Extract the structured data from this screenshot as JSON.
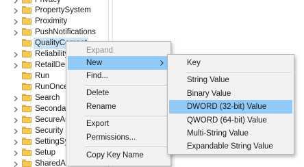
{
  "tree": {
    "items": [
      {
        "label": "Privacy"
      },
      {
        "label": "PropertySystem"
      },
      {
        "label": "Proximity"
      },
      {
        "label": "PushNotifications"
      },
      {
        "label": "QualityCompat"
      },
      {
        "label": "Reliability"
      },
      {
        "label": "RetailDemo"
      },
      {
        "label": "Run"
      },
      {
        "label": "RunOnce"
      },
      {
        "label": "Search"
      },
      {
        "label": "SecondaryAuth"
      },
      {
        "label": "SecureAssessment"
      },
      {
        "label": "Security and Maintenance"
      },
      {
        "label": "SettingSync"
      },
      {
        "label": "Setup"
      },
      {
        "label": "SharedAccess"
      }
    ]
  },
  "context_menu": {
    "expand": "Expand",
    "new": "New",
    "find": "Find...",
    "delete": "Delete",
    "rename": "Rename",
    "export": "Export",
    "permissions": "Permissions...",
    "copy_key_name": "Copy Key Name"
  },
  "new_submenu": {
    "key": "Key",
    "string_value": "String Value",
    "binary_value": "Binary Value",
    "dword_value": "DWORD (32-bit) Value",
    "qword_value": "QWORD (64-bit) Value",
    "multi_string_value": "Multi-String Value",
    "expandable_string_value": "Expandable String Value"
  },
  "colors": {
    "highlight": "#91c9f7",
    "selected_tree_item": "#cce4f7",
    "folder": "#f3c95a",
    "menu_background": "#f2f2f2"
  }
}
